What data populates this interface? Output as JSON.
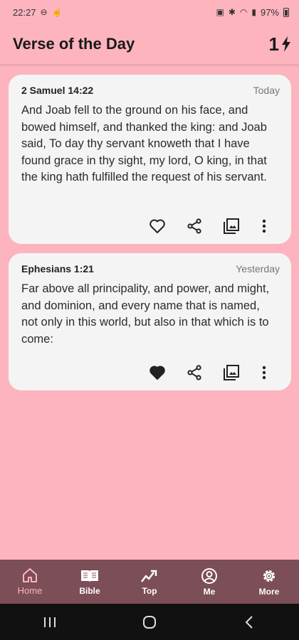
{
  "status": {
    "time": "22:27",
    "battery": "97%"
  },
  "app": {
    "title": "Verse of the Day",
    "streak": "1"
  },
  "cards": [
    {
      "reference": "2 Samuel 14:22",
      "day": "Today",
      "text": "And Joab fell to the ground on his face, and bowed himself, and thanked the king: and Joab said, To day thy servant knoweth that I have found grace in thy sight, my lord, O king, in that the king hath fulfilled the request of his servant.",
      "liked": false
    },
    {
      "reference": "Ephesians 1:21",
      "day": "Yesterday",
      "text": "Far above all principality, and power, and might, and dominion, and every name that is named, not only in this world, but also in that which is to come:",
      "liked": true
    }
  ],
  "nav": {
    "items": [
      {
        "label": "Home",
        "icon": "home-icon",
        "active": true
      },
      {
        "label": "Bible",
        "icon": "book-icon",
        "active": false
      },
      {
        "label": "Top",
        "icon": "trending-icon",
        "active": false
      },
      {
        "label": "Me",
        "icon": "account-icon",
        "active": false
      },
      {
        "label": "More",
        "icon": "gear-icon",
        "active": false
      }
    ]
  },
  "colors": {
    "background": "#FDB4BF",
    "nav": "#7C4E57",
    "card": "#F4F4F4",
    "active_nav": "#FDB4BF"
  }
}
